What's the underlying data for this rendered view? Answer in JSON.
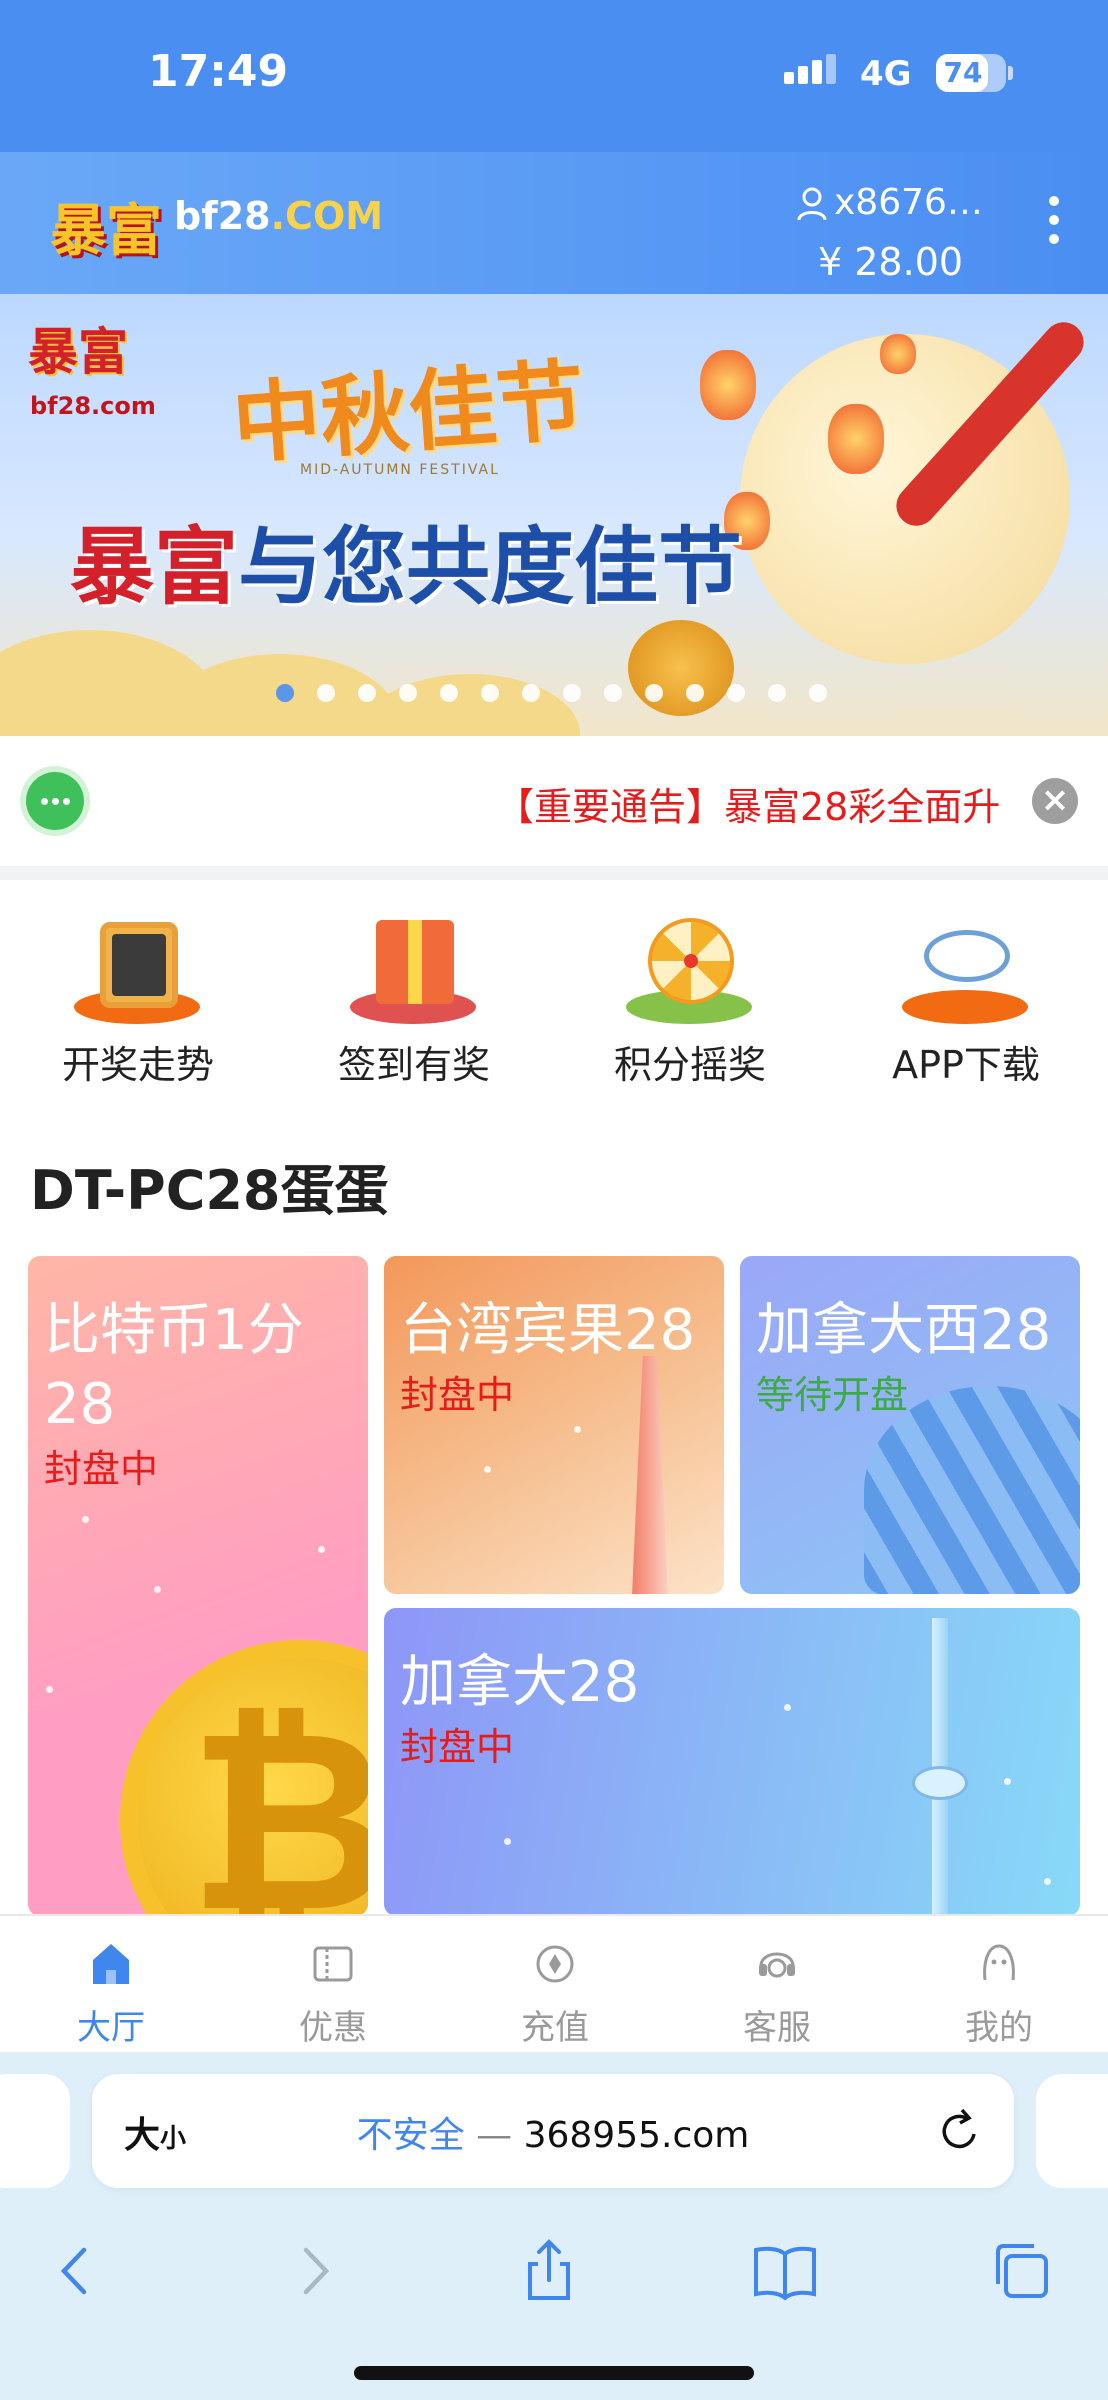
{
  "status_bar": {
    "time": "17:49",
    "network": "4G",
    "battery": "74",
    "battery_level": 0.74
  },
  "header": {
    "logo_cn": "暴富",
    "logo_domain": "bf28",
    "logo_tld": ".COM",
    "username": "x8676…",
    "balance": "¥ 28.00"
  },
  "banner": {
    "logo_cn": "暴富",
    "logo_domain": "bf28.com",
    "title": "中秋佳节",
    "subtitle_en": "MID-AUTUMN FESTIVAL",
    "slogan_brand": "暴富",
    "slogan_rest": "与您共度佳节",
    "slide_count": 14,
    "active_slide": 0
  },
  "notice": {
    "text": "【重要通告】暴富28彩全面升"
  },
  "quick_menu": [
    {
      "label": "开奖走势",
      "icon": "trend-chart-icon"
    },
    {
      "label": "签到有奖",
      "icon": "gift-box-icon"
    },
    {
      "label": "积分摇奖",
      "icon": "prize-wheel-icon"
    },
    {
      "label": "APP下载",
      "icon": "cloud-download-icon"
    }
  ],
  "section": {
    "title": "DT-PC28蛋蛋"
  },
  "games": [
    {
      "title_line1": "比特币1分",
      "title_line2": "28",
      "status": "封盘中",
      "status_color": "#e81b1b"
    },
    {
      "title": "台湾宾果28",
      "status": "封盘中",
      "status_color": "#e81b1b"
    },
    {
      "title": "加拿大西28",
      "status": "等待开盘",
      "status_color": "#3caa47"
    },
    {
      "title": "加拿大28",
      "status": "封盘中",
      "status_color": "#e81b1b"
    }
  ],
  "bottom_nav": [
    {
      "label": "大厅",
      "active": true
    },
    {
      "label": "优惠",
      "active": false
    },
    {
      "label": "充值",
      "active": false
    },
    {
      "label": "客服",
      "active": false
    },
    {
      "label": "我的",
      "active": false
    }
  ],
  "browser": {
    "aa_big": "大",
    "aa_small": "小",
    "insecure": "不安全",
    "separator": "—",
    "domain": "368955.com"
  },
  "colors": {
    "primary": "#4a8ef2",
    "active_nav": "#3f86ee",
    "closed_status": "#e81b1b",
    "waiting_status": "#3caa47"
  }
}
